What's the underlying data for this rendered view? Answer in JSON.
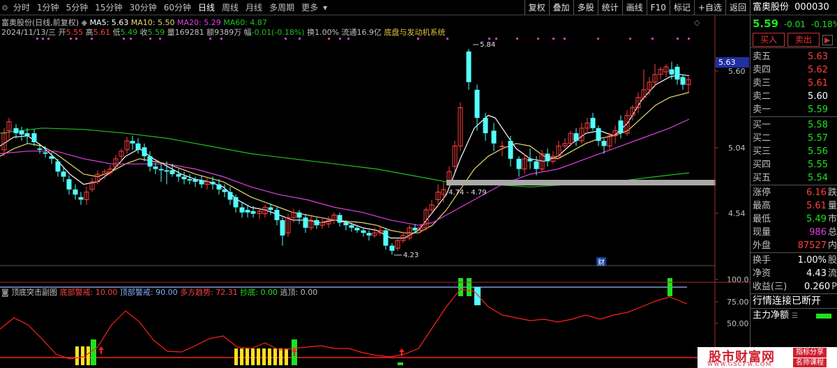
{
  "toolbar": {
    "periods": [
      {
        "label": "分时"
      },
      {
        "label": "1分钟"
      },
      {
        "label": "5分钟"
      },
      {
        "label": "15分钟"
      },
      {
        "label": "30分钟"
      },
      {
        "label": "60分钟"
      },
      {
        "label": "日线",
        "active": true
      },
      {
        "label": "周线"
      },
      {
        "label": "月线"
      },
      {
        "label": "多周期"
      },
      {
        "label": "更多"
      }
    ],
    "more_icon": "chevron-down-icon",
    "tools": [
      "复权",
      "叠加",
      "多股",
      "统计",
      "画线",
      "F10",
      "标记",
      "+自选",
      "返回"
    ]
  },
  "info": {
    "name": "富奥股份(日线,前复权)",
    "ma5_label": "MA5: 5.63",
    "ma10_label": "MA10: 5.50",
    "ma20_label": "MA20: 5.29",
    "ma60_label": "MA60: 4.87",
    "date": "2024/11/13/三",
    "open_l": "开",
    "open": "5.55",
    "high_l": "高",
    "high": "5.61",
    "low_l": "低",
    "low": "5.49",
    "close_l": "收",
    "close": "5.59",
    "vol_l": "量",
    "vol": "169281",
    "amt_l": "额",
    "amt": "9389万",
    "chg_l": "幅",
    "chg": "-0.01(-0.18%)",
    "turnover": "换1.00%",
    "float": "流通16.9亿",
    "sector": "底盘与发动机系统"
  },
  "indicator": {
    "name": "顶底突击副图",
    "bottom_warn": "底部警戒: 10.00",
    "top_warn": "顶部警戒: 90.00",
    "trend": "多方趋势: 72.31",
    "buy": "抄底: 0.00",
    "escape": "逃顶: 0.00"
  },
  "axis": {
    "price_ticks": [
      "5.60",
      "5.04",
      "4.54"
    ],
    "current_price_tag": "5.63",
    "ind_ticks": [
      "100.0",
      "75.00",
      "50.00"
    ]
  },
  "annotations": {
    "high_label": "5.84",
    "low_label": "4.23",
    "gap_label": "4.74 - 4.79",
    "event_label": "财"
  },
  "quote": {
    "name": "富奥股份",
    "code": "000030",
    "price": "5.59",
    "change": "-0.01",
    "pct": "-0.18%",
    "buy_btn": "买入",
    "sell_btn": "卖出",
    "asks": [
      {
        "label": "卖五",
        "price": "5.63"
      },
      {
        "label": "卖四",
        "price": "5.62"
      },
      {
        "label": "卖三",
        "price": "5.61"
      },
      {
        "label": "卖二",
        "price": "5.60"
      },
      {
        "label": "卖一",
        "price": "5.59"
      }
    ],
    "bids": [
      {
        "label": "买一",
        "price": "5.58"
      },
      {
        "label": "买二",
        "price": "5.57"
      },
      {
        "label": "买三",
        "price": "5.56"
      },
      {
        "label": "买四",
        "price": "5.55"
      },
      {
        "label": "买五",
        "price": "5.54"
      }
    ],
    "stats": [
      {
        "label": "涨停",
        "value": "6.16",
        "suffix": "跌"
      },
      {
        "label": "最高",
        "value": "5.61",
        "suffix": "量"
      },
      {
        "label": "最低",
        "value": "5.49",
        "suffix": "市"
      },
      {
        "label": "现量",
        "value": "986",
        "suffix": "总"
      },
      {
        "label": "外盘",
        "value": "87527",
        "suffix": "内"
      }
    ],
    "stats2": [
      {
        "label": "换手",
        "value": "1.00%",
        "suffix": "股"
      },
      {
        "label": "净资",
        "value": "4.43",
        "suffix": "流"
      },
      {
        "label": "收益(三)",
        "value": "0.260",
        "suffix": "P"
      }
    ],
    "status": "行情连接已断开",
    "net_flow_label": "主力净额"
  },
  "watermark": {
    "title": "股市财富网",
    "url": "WWW.GSCFW.COM",
    "badge1": "指标分享",
    "badge2": "名师课程"
  },
  "colors": {
    "up": "#ff4040",
    "down": "#54ffff",
    "ma5": "#ffffff",
    "ma10": "#e8d870",
    "ma20": "#e040e0",
    "ma60": "#20c020"
  },
  "chart_data": {
    "type": "candlestick",
    "last": {
      "date": "2024/11/13",
      "open": 5.55,
      "high": 5.61,
      "low": 5.49,
      "close": 5.59
    },
    "ma": {
      "MA5": 5.63,
      "MA10": 5.5,
      "MA20": 5.29,
      "MA60": 4.87
    },
    "marked_high": 5.84,
    "marked_low": 4.23,
    "y_ticks": [
      5.6,
      5.04,
      4.54
    ],
    "indicator_y_ticks": [
      100,
      75,
      50
    ]
  }
}
